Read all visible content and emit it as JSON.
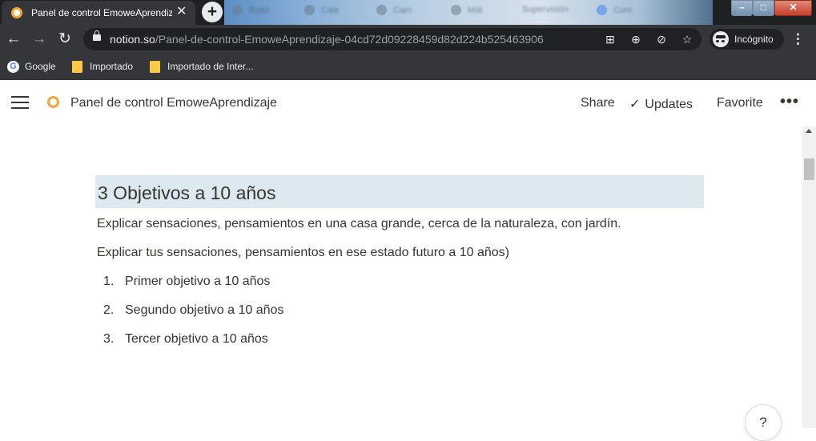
{
  "browser": {
    "active_tab_title": "Panel de control EmoweAprendizaje",
    "background_tabs": [
      "Buzó",
      "Cale",
      "Cam",
      "Mát",
      "Supervisión",
      "Cont"
    ],
    "address": {
      "host": "notion.so",
      "path": "/Panel-de-control-EmoweAprendizaje-04cd72d09228459d82d224b525463906"
    },
    "incognito_label": "Incógnito",
    "bookmarks": [
      {
        "label": "Google",
        "icon": "google-icon"
      },
      {
        "label": "Importado",
        "icon": "folder-icon"
      },
      {
        "label": "Importado de Inter...",
        "icon": "folder-icon"
      }
    ],
    "colors": {
      "frame": "#35363a",
      "tabstrip": "#1f2022",
      "omnibox": "#202124"
    }
  },
  "notion": {
    "page_title": "Panel de control EmoweAprendizaje",
    "actions": {
      "share": "Share",
      "updates": "Updates",
      "favorite": "Favorite"
    },
    "heading": "3 Objetivos a 10 años",
    "heading_bg": "#dde9f0",
    "paragraphs": [
      "Explicar sensaciones, pensamientos en una casa grande, cerca de la naturaleza, con jardín.",
      "Explicar tus sensaciones, pensamientos en ese estado futuro a 10 años)"
    ],
    "list": [
      {
        "num": "1.",
        "text": "Primer objetivo a 10 años"
      },
      {
        "num": "2.",
        "text": "Segundo objetivo a 10 años"
      },
      {
        "num": "3.",
        "text": "Tercer objetivo a 10 años"
      }
    ],
    "help_label": "?"
  }
}
